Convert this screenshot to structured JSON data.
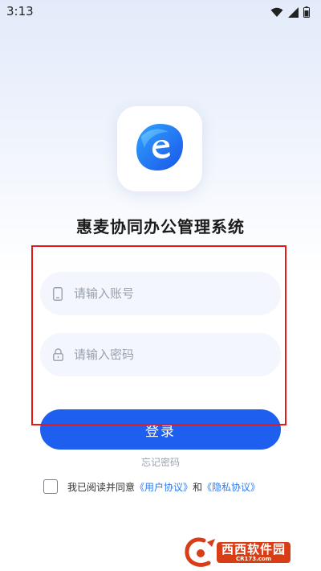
{
  "status_bar": {
    "time": "3:13",
    "icons": [
      "wifi-icon",
      "signal-icon",
      "battery-icon"
    ]
  },
  "app": {
    "title": "惠麦协同办公管理系统",
    "logo_icon": "e-logo-icon"
  },
  "form": {
    "account": {
      "placeholder": "请输入账号",
      "value": "",
      "icon": "phone-icon"
    },
    "password": {
      "placeholder": "请输入密码",
      "value": "",
      "icon": "lock-icon"
    },
    "login_label": "登录",
    "forgot_label": "忘记密码"
  },
  "agreement": {
    "checked": false,
    "prefix": "我已阅读并同意",
    "user_agreement": "《用户协议》",
    "conjunction": "和",
    "privacy_policy": "《隐私协议》"
  },
  "watermark": {
    "name": "西西软件园",
    "sub": "CR173.com"
  },
  "colors": {
    "primary": "#1e5ff0",
    "link": "#2e7bf2",
    "field_bg": "#f3f6fd",
    "highlight": "#e01b1b"
  }
}
